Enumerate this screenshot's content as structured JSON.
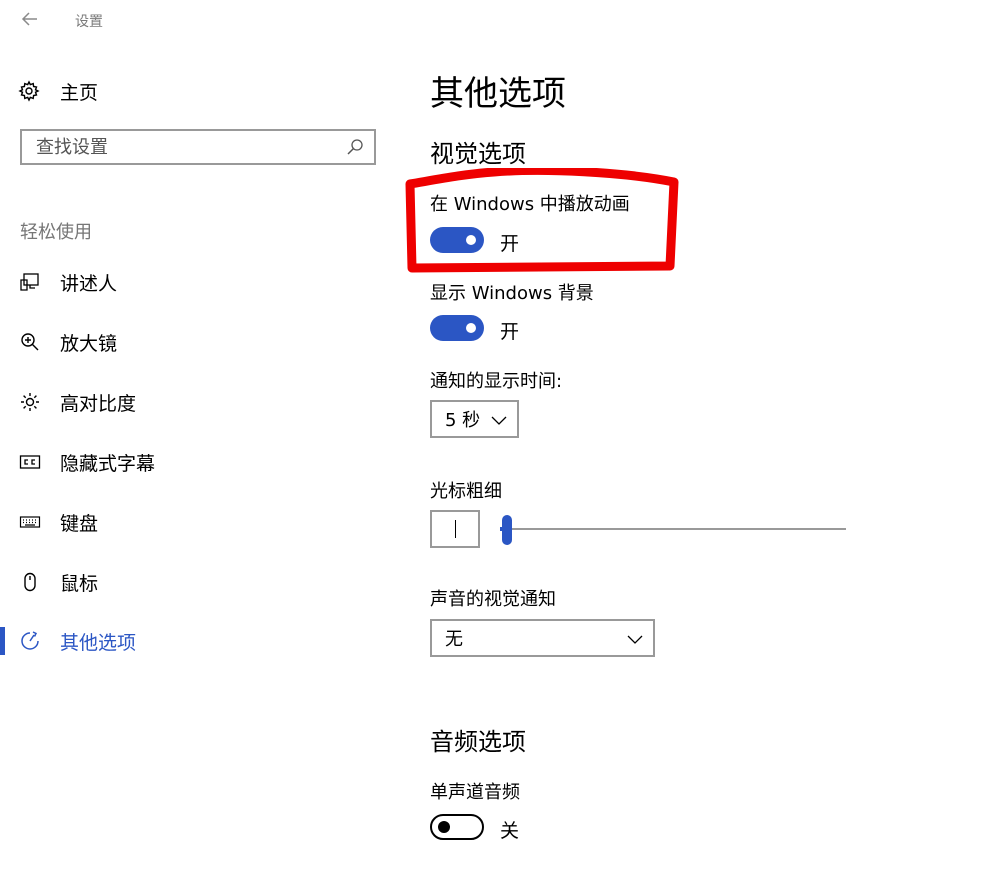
{
  "window": {
    "title": "设置"
  },
  "sidebar": {
    "home": {
      "label": "主页",
      "icon": "gear-icon"
    },
    "search": {
      "placeholder": "查找设置",
      "icon": "search-icon"
    },
    "section_label": "轻松使用",
    "items": [
      {
        "label": "讲述人",
        "icon": "narrator-icon",
        "active": false
      },
      {
        "label": "放大镜",
        "icon": "magnifier-icon",
        "active": false
      },
      {
        "label": "高对比度",
        "icon": "brightness-icon",
        "active": false
      },
      {
        "label": "隐藏式字幕",
        "icon": "closed-captions-icon",
        "active": false
      },
      {
        "label": "键盘",
        "icon": "keyboard-icon",
        "active": false
      },
      {
        "label": "鼠标",
        "icon": "mouse-icon",
        "active": false
      },
      {
        "label": "其他选项",
        "icon": "other-options-icon",
        "active": true
      }
    ]
  },
  "main": {
    "title": "其他选项",
    "visual": {
      "heading": "视觉选项",
      "play_animations": {
        "label": "在 Windows 中播放动画",
        "state": "开",
        "on": true
      },
      "show_background": {
        "label": "显示 Windows 背景",
        "state": "开",
        "on": true
      },
      "notification_time": {
        "label": "通知的显示时间:",
        "value": "5 秒"
      },
      "cursor_thickness": {
        "label": "光标粗细",
        "level": 0.02
      },
      "sound_visual": {
        "label": "声音的视觉通知",
        "value": "无"
      }
    },
    "audio": {
      "heading": "音频选项",
      "mono_audio": {
        "label": "单声道音频",
        "state": "关",
        "on": false
      }
    }
  },
  "colors": {
    "accent": "#2b56c4",
    "annotation": "#ee0000",
    "border": "#999999"
  }
}
